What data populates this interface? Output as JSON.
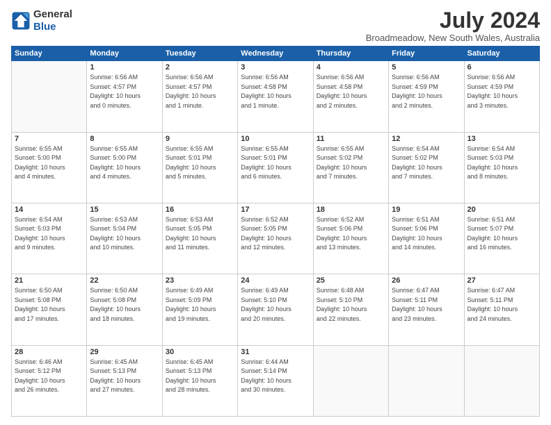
{
  "header": {
    "logo_line1": "General",
    "logo_line2": "Blue",
    "title": "July 2024",
    "subtitle": "Broadmeadow, New South Wales, Australia"
  },
  "weekdays": [
    "Sunday",
    "Monday",
    "Tuesday",
    "Wednesday",
    "Thursday",
    "Friday",
    "Saturday"
  ],
  "weeks": [
    [
      {
        "day": "",
        "info": ""
      },
      {
        "day": "1",
        "info": "Sunrise: 6:56 AM\nSunset: 4:57 PM\nDaylight: 10 hours\nand 0 minutes."
      },
      {
        "day": "2",
        "info": "Sunrise: 6:56 AM\nSunset: 4:57 PM\nDaylight: 10 hours\nand 1 minute."
      },
      {
        "day": "3",
        "info": "Sunrise: 6:56 AM\nSunset: 4:58 PM\nDaylight: 10 hours\nand 1 minute."
      },
      {
        "day": "4",
        "info": "Sunrise: 6:56 AM\nSunset: 4:58 PM\nDaylight: 10 hours\nand 2 minutes."
      },
      {
        "day": "5",
        "info": "Sunrise: 6:56 AM\nSunset: 4:59 PM\nDaylight: 10 hours\nand 2 minutes."
      },
      {
        "day": "6",
        "info": "Sunrise: 6:56 AM\nSunset: 4:59 PM\nDaylight: 10 hours\nand 3 minutes."
      }
    ],
    [
      {
        "day": "7",
        "info": "Sunrise: 6:55 AM\nSunset: 5:00 PM\nDaylight: 10 hours\nand 4 minutes."
      },
      {
        "day": "8",
        "info": "Sunrise: 6:55 AM\nSunset: 5:00 PM\nDaylight: 10 hours\nand 4 minutes."
      },
      {
        "day": "9",
        "info": "Sunrise: 6:55 AM\nSunset: 5:01 PM\nDaylight: 10 hours\nand 5 minutes."
      },
      {
        "day": "10",
        "info": "Sunrise: 6:55 AM\nSunset: 5:01 PM\nDaylight: 10 hours\nand 6 minutes."
      },
      {
        "day": "11",
        "info": "Sunrise: 6:55 AM\nSunset: 5:02 PM\nDaylight: 10 hours\nand 7 minutes."
      },
      {
        "day": "12",
        "info": "Sunrise: 6:54 AM\nSunset: 5:02 PM\nDaylight: 10 hours\nand 7 minutes."
      },
      {
        "day": "13",
        "info": "Sunrise: 6:54 AM\nSunset: 5:03 PM\nDaylight: 10 hours\nand 8 minutes."
      }
    ],
    [
      {
        "day": "14",
        "info": "Sunrise: 6:54 AM\nSunset: 5:03 PM\nDaylight: 10 hours\nand 9 minutes."
      },
      {
        "day": "15",
        "info": "Sunrise: 6:53 AM\nSunset: 5:04 PM\nDaylight: 10 hours\nand 10 minutes."
      },
      {
        "day": "16",
        "info": "Sunrise: 6:53 AM\nSunset: 5:05 PM\nDaylight: 10 hours\nand 11 minutes."
      },
      {
        "day": "17",
        "info": "Sunrise: 6:52 AM\nSunset: 5:05 PM\nDaylight: 10 hours\nand 12 minutes."
      },
      {
        "day": "18",
        "info": "Sunrise: 6:52 AM\nSunset: 5:06 PM\nDaylight: 10 hours\nand 13 minutes."
      },
      {
        "day": "19",
        "info": "Sunrise: 6:51 AM\nSunset: 5:06 PM\nDaylight: 10 hours\nand 14 minutes."
      },
      {
        "day": "20",
        "info": "Sunrise: 6:51 AM\nSunset: 5:07 PM\nDaylight: 10 hours\nand 16 minutes."
      }
    ],
    [
      {
        "day": "21",
        "info": "Sunrise: 6:50 AM\nSunset: 5:08 PM\nDaylight: 10 hours\nand 17 minutes."
      },
      {
        "day": "22",
        "info": "Sunrise: 6:50 AM\nSunset: 5:08 PM\nDaylight: 10 hours\nand 18 minutes."
      },
      {
        "day": "23",
        "info": "Sunrise: 6:49 AM\nSunset: 5:09 PM\nDaylight: 10 hours\nand 19 minutes."
      },
      {
        "day": "24",
        "info": "Sunrise: 6:49 AM\nSunset: 5:10 PM\nDaylight: 10 hours\nand 20 minutes."
      },
      {
        "day": "25",
        "info": "Sunrise: 6:48 AM\nSunset: 5:10 PM\nDaylight: 10 hours\nand 22 minutes."
      },
      {
        "day": "26",
        "info": "Sunrise: 6:47 AM\nSunset: 5:11 PM\nDaylight: 10 hours\nand 23 minutes."
      },
      {
        "day": "27",
        "info": "Sunrise: 6:47 AM\nSunset: 5:11 PM\nDaylight: 10 hours\nand 24 minutes."
      }
    ],
    [
      {
        "day": "28",
        "info": "Sunrise: 6:46 AM\nSunset: 5:12 PM\nDaylight: 10 hours\nand 26 minutes."
      },
      {
        "day": "29",
        "info": "Sunrise: 6:45 AM\nSunset: 5:13 PM\nDaylight: 10 hours\nand 27 minutes."
      },
      {
        "day": "30",
        "info": "Sunrise: 6:45 AM\nSunset: 5:13 PM\nDaylight: 10 hours\nand 28 minutes."
      },
      {
        "day": "31",
        "info": "Sunrise: 6:44 AM\nSunset: 5:14 PM\nDaylight: 10 hours\nand 30 minutes."
      },
      {
        "day": "",
        "info": ""
      },
      {
        "day": "",
        "info": ""
      },
      {
        "day": "",
        "info": ""
      }
    ]
  ]
}
